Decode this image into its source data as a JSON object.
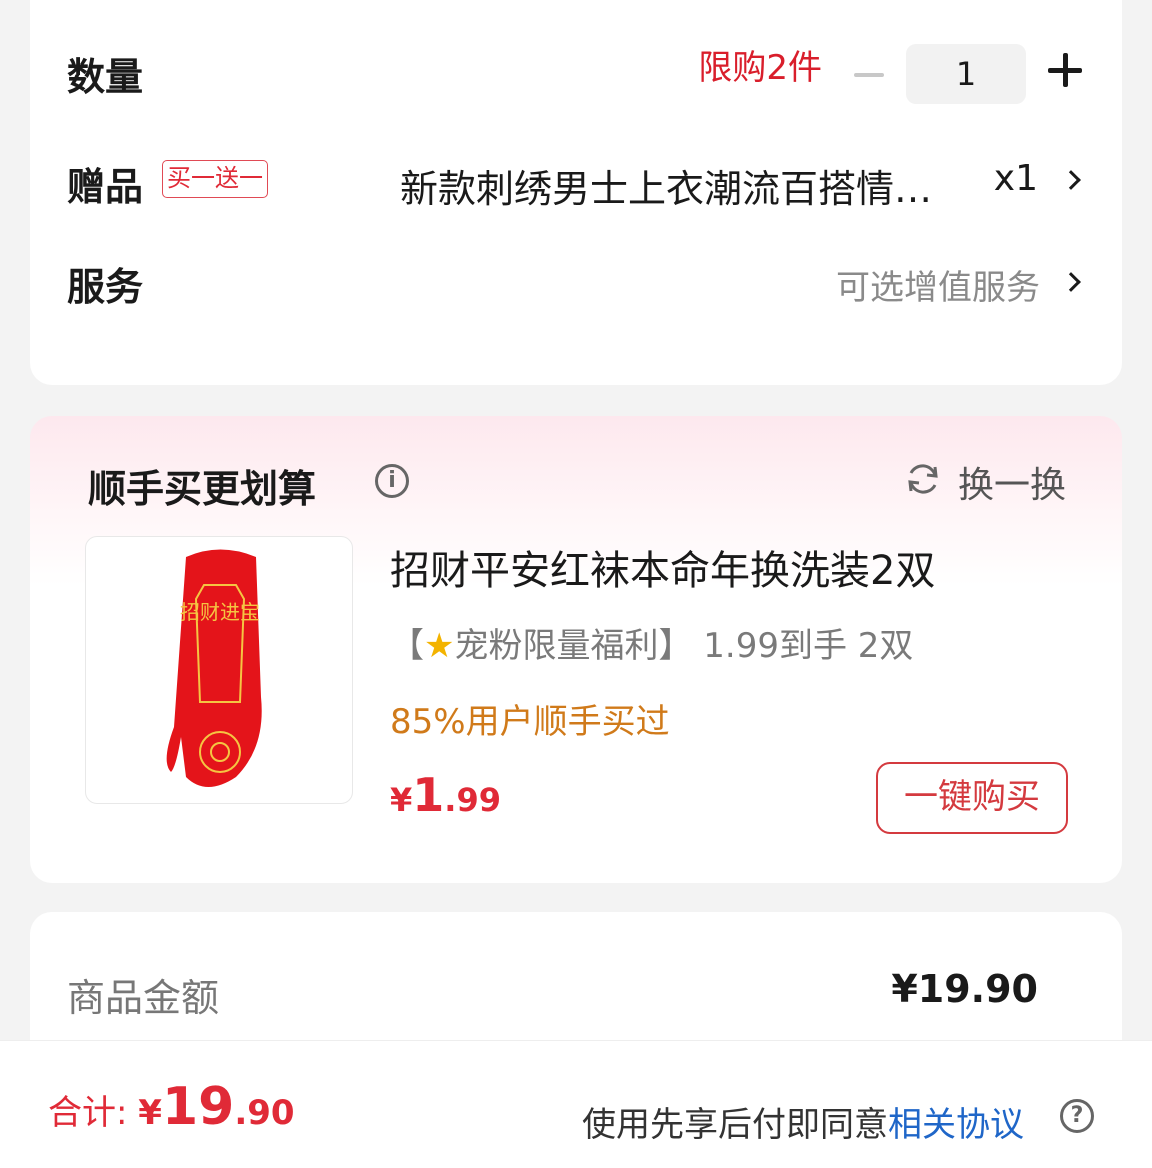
{
  "quantity_section": {
    "label": "数量",
    "limit_text": "限购2件",
    "value": "1"
  },
  "gift_section": {
    "label": "赠品",
    "badge": "买一送一",
    "item_name": "新款刺绣男士上衣潮流百搭情…",
    "item_qty": "x1"
  },
  "service_section": {
    "label": "服务",
    "value": "可选增值服务"
  },
  "bundle": {
    "title": "顺手买更划算",
    "refresh_label": "换一换",
    "product": {
      "name": "招财平安红袜本命年换洗装2双",
      "promo_prefix": "【",
      "promo_badge": "宠粉限量福利",
      "promo_suffix": "】 1.99到手 2双",
      "stat": "85%用户顺手买过",
      "price_currency": "¥",
      "price_int": "1",
      "price_dec": ".99",
      "buy_label": "一键购买",
      "image_text": "招财进宝"
    }
  },
  "amount_section": {
    "label": "商品金额",
    "value": "¥19.90"
  },
  "bottom_bar": {
    "total_label": "合计: ",
    "total_currency": "¥",
    "total_int": "19",
    "total_dec": ".90",
    "agree_text": "使用先享后付即同意",
    "agree_link": "相关协议"
  },
  "icons": {
    "minus": "minus-icon",
    "plus": "plus-icon",
    "chevron": "chevron-right-icon",
    "info": "info-icon",
    "refresh": "refresh-icon",
    "star": "star-icon",
    "help": "help-icon"
  },
  "colors": {
    "accent_red": "#e02a37",
    "link_blue": "#1f66c8",
    "stat_orange": "#d07a1a"
  }
}
